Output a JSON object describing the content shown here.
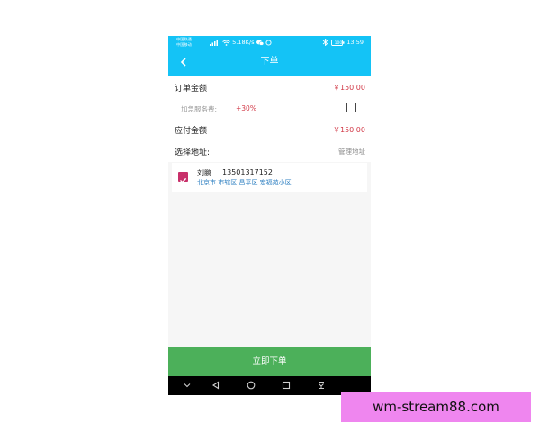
{
  "status_bar": {
    "carrier_top": "中国联通",
    "carrier_bottom": "中国移动",
    "network_speed": "5.18K/s",
    "battery": "100",
    "time": "13:59",
    "icons": [
      "signal-icon",
      "wifi-icon",
      "wechat-icon",
      "bluetooth-icon",
      "battery-icon"
    ]
  },
  "header": {
    "back_icon": "back-arrow-icon",
    "title": "下单"
  },
  "order": {
    "order_amount_label": "订单金额",
    "order_amount_value": "￥150.00",
    "rush_fee_label": "加急服务费:",
    "rush_fee_value": "+30%",
    "rush_checked": false,
    "payable_label": "应付金额",
    "payable_value": "￥150.00",
    "address_label": "选择地址:",
    "manage_address": "管理地址"
  },
  "address": {
    "checked": true,
    "name": "刘鹏",
    "phone": "13501317152",
    "detail": "北京市 市辖区 昌平区 宏福苑小区"
  },
  "submit_label": "立即下单",
  "android_nav": [
    "collapse-icon",
    "back-triangle-icon",
    "home-circle-icon",
    "recents-square-icon",
    "notification-pull-icon"
  ],
  "watermark_text": "wm-stream88.com",
  "colors": {
    "primary": "#14c3f6",
    "price": "#d23a48",
    "checkbox": "#c8306a",
    "submit": "#4cb05a",
    "address_link": "#2d7fc1",
    "watermark_bg": "#ef86ef"
  }
}
